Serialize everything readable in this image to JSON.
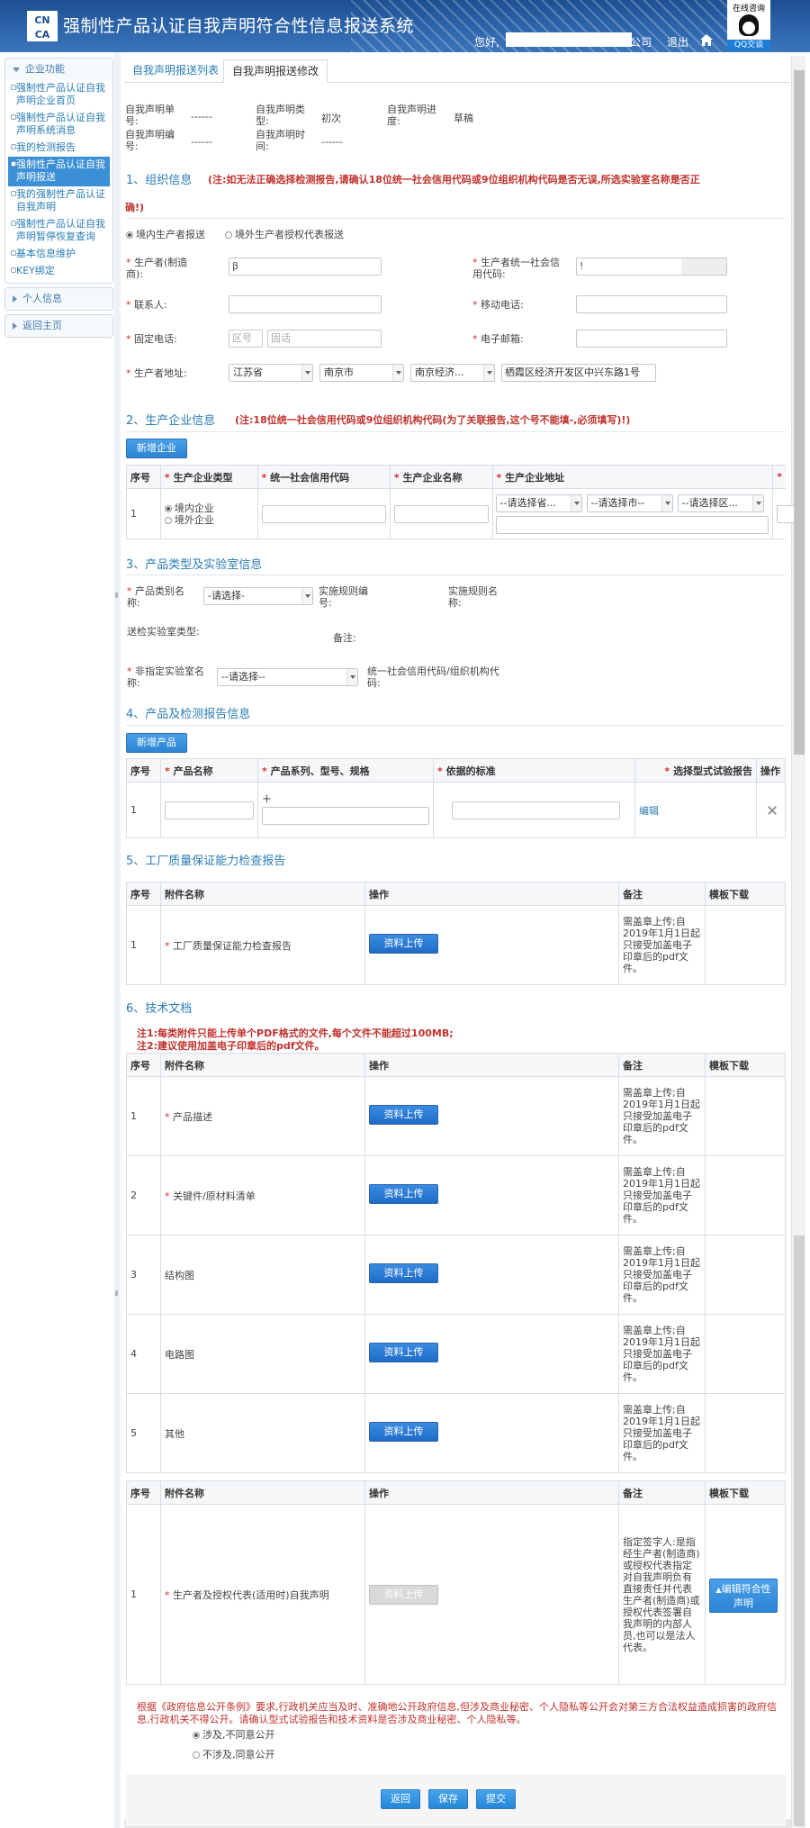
{
  "header": {
    "logo_line1": "CN",
    "logo_line2": "CA",
    "title": "强制性产品认证自我声明符合性信息报送系统",
    "user_prefix": "您好,",
    "user_suffix": "公司",
    "logout": "退出",
    "online": "在线咨询",
    "qq": "QQ交谈"
  },
  "sidebar": {
    "group1": "企业功能",
    "items": [
      "强制性产品认证自我声明企业首页",
      "强制性产品认证自我声明系统消息",
      "我的检测报告",
      "强制性产品认证自我声明报送",
      "我的强制性产品认证自我声明",
      "强制性产品认证自我声明暂停恢复查询",
      "基本信息维护",
      "KEY绑定"
    ],
    "group2": "个人信息",
    "group3": "返回主页"
  },
  "tabs": [
    "自我声明报送列表",
    "自我声明报送修改"
  ],
  "meta": {
    "no_label": "自我声明单号:",
    "no_val": "------",
    "type_label": "自我声明类型:",
    "type_val": "初次",
    "progress_label": "自我声明进度:",
    "progress_val": "草稿",
    "edit_label": "自我声明编号:",
    "edit_val": "------",
    "time_label": "自我声明时间:",
    "time_val": "------"
  },
  "s1": {
    "title": "1、组织信息",
    "warn1": "(注:如无法正确选择检测报告,请确认18位统一社会信用代码或9位组织机构代码是否无误,所选实验室名称是否正",
    "warn2": "确!)",
    "radio1": "境内生产者报送",
    "radio2": "境外生产者授权代表报送",
    "maker_label": "生产者(制造商):",
    "maker_val": "β",
    "credit_label": "生产者统一社会信用代码:",
    "credit_val": "!",
    "contact_label": "联系人:",
    "mobile_label": "移动电话:",
    "phone_label": "固定电话:",
    "area_ph": "区号",
    "phone_ph": "固话",
    "email_label": "电子邮箱:",
    "addr_label": "生产者地址:",
    "prov": "江苏省",
    "city": "南京市",
    "dist": "南京经济...",
    "addr_val": "栖霞区经济开发区中兴东路1号"
  },
  "s2": {
    "title": "2、生产企业信息",
    "warn": "(注:18位统一社会信用代码或9位组织机构代码(为了关联报告,这个号不能填-,必须填写)!)",
    "add_btn": "新增企业",
    "headers": [
      "序号",
      "生产企业类型",
      "统一社会信用代码",
      "生产企业名称",
      "生产企业地址"
    ],
    "row_no": "1",
    "type1": "境内企业",
    "type2": "境外企业",
    "prov_ph": "--请选择省...",
    "city_ph": "--请选择市--",
    "dist_ph": "--请选择区..."
  },
  "s3": {
    "title": "3、产品类型及实验室信息",
    "cat_label": "产品类别名称:",
    "cat_ph": "-请选择-",
    "rule_no_label": "实施规则编号:",
    "rule_name_label": "实施规则名称:",
    "lab_type_label": "送检实验室类型:",
    "remark_label": "备注:",
    "lab_name_label": "非指定实验室名称:",
    "lab_ph": "--请选择--",
    "lab_code_label": "统一社会信用代码/组织机构代码:"
  },
  "s4": {
    "title": "4、产品及检测报告信息",
    "add_btn": "新增产品",
    "headers": [
      "序号",
      "产品名称",
      "产品系列、型号、规格",
      "依据的标准",
      "选择型式试验报告",
      "操作"
    ],
    "row_no": "1",
    "plus": "+",
    "edit": "编辑"
  },
  "s5": {
    "title": "5、工厂质量保证能力检查报告",
    "headers": [
      "序号",
      "附件名称",
      "操作",
      "备注",
      "模板下载"
    ],
    "rows": [
      {
        "no": "1",
        "name": "工厂质量保证能力检查报告",
        "btn": "资料上传",
        "note": "需盖章上传;自2019年1月1日起只接受加盖电子印章后的pdf文件。"
      }
    ]
  },
  "s6": {
    "title": "6、技术文档",
    "note1": "注1:每类附件只能上传单个PDF格式的文件,每个文件不能超过100MB;",
    "note2": "注2:建议使用加盖电子印章后的pdf文件。",
    "headers": [
      "序号",
      "附件名称",
      "操作",
      "备注",
      "模板下载"
    ],
    "rows": [
      {
        "no": "1",
        "name": "产品描述",
        "btn": "资料上传",
        "note": "需盖章上传;自2019年1月1日起只接受加盖电子印章后的pdf文件。"
      },
      {
        "no": "2",
        "name": "关键件/原材料清单",
        "btn": "资料上传",
        "note": "需盖章上传;自2019年1月1日起只接受加盖电子印章后的pdf文件。"
      },
      {
        "no": "3",
        "name": "结构图",
        "btn": "资料上传",
        "note": "需盖章上传;自2019年1月1日起只接受加盖电子印章后的pdf文件。"
      },
      {
        "no": "4",
        "name": "电路图",
        "btn": "资料上传",
        "note": "需盖章上传;自2019年1月1日起只接受加盖电子印章后的pdf文件。"
      },
      {
        "no": "5",
        "name": "其他",
        "btn": "资料上传",
        "note": "需盖章上传;自2019年1月1日起只接受加盖电子印章后的pdf文件。"
      }
    ]
  },
  "s7": {
    "headers": [
      "序号",
      "附件名称",
      "操作",
      "备注",
      "模板下载"
    ],
    "no": "1",
    "name": "生产者及授权代表(适用时)自我声明",
    "btn": "资料上传",
    "note": "指定签字人:是指经生产者(制造商)或授权代表指定对自我声明负有直接责任并代表生产者(制造商)或授权代表签署自我声明的内部人员,也可以是法人代表。",
    "tpl": "编辑符合性声明"
  },
  "disclose": {
    "text": "根据《政府信息公开条例》要求,行政机关应当及时、准确地公开政府信息,但涉及商业秘密、个人隐私等公开会对第三方合法权益造成损害的政府信息,行政机关不得公开。请确认型式试验报告和技术资料是否涉及商业秘密、个人隐私等。",
    "opt1": "涉及,不同意公开",
    "opt2": "不涉及,同意公开"
  },
  "footer": {
    "back": "返回",
    "save": "保存",
    "submit": "提交"
  }
}
